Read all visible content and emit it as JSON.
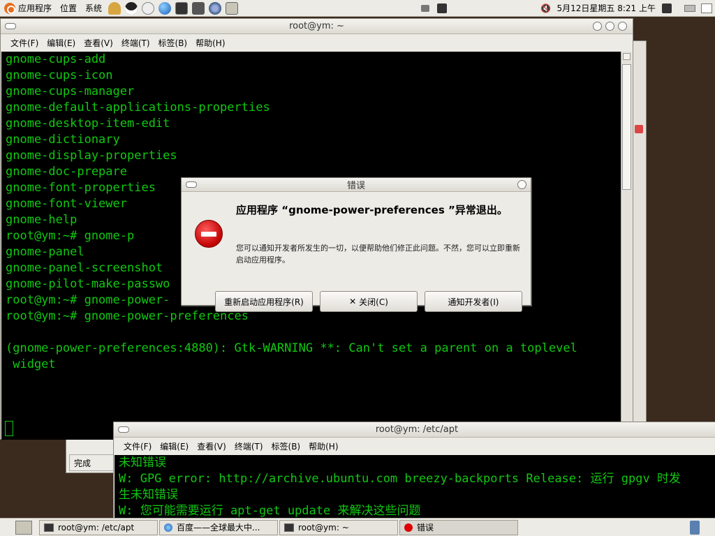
{
  "top_panel": {
    "menus": [
      "应用程序",
      "位置",
      "系统"
    ],
    "clock": "5月12日星期五  8:21 上午"
  },
  "main_window": {
    "title": "root@ym: ~",
    "menus": [
      "文件(F)",
      "编辑(E)",
      "查看(V)",
      "终端(T)",
      "标签(B)",
      "帮助(H)"
    ],
    "lines": [
      "gnome-cups-add",
      "gnome-cups-icon",
      "gnome-cups-manager",
      "gnome-default-applications-properties",
      "gnome-desktop-item-edit",
      "gnome-dictionary",
      "gnome-display-properties",
      "gnome-doc-prepare",
      "gnome-font-properties",
      "gnome-font-viewer",
      "gnome-help",
      "root@ym:~# gnome-p",
      "gnome-panel",
      "gnome-panel-screenshot",
      "gnome-pilot-make-passwo",
      "root@ym:~# gnome-power-",
      "root@ym:~# gnome-power-preferences",
      "",
      "(gnome-power-preferences:4880): Gtk-WARNING **: Can't set a parent on a toplevel",
      " widget"
    ]
  },
  "dialog": {
    "title": "错误",
    "heading": "应用程序 “gnome-power-preferences ”异常退出。",
    "message": "您可以通知开发者所发生的一切，以便帮助他们修正此问题。不然，您可以立即重新启动应用程序。",
    "restart_label": "重新启动应用程序(R)",
    "close_label": "关闭(C)",
    "notify_label": "通知开发者(I)"
  },
  "back_window": {
    "status": "完成"
  },
  "apt_window": {
    "title": "root@ym: /etc/apt",
    "menus": [
      "文件(F)",
      "编辑(E)",
      "查看(V)",
      "终端(T)",
      "标签(B)",
      "帮助(H)"
    ],
    "lines": [
      "未知错误",
      "W: GPG error: http://archive.ubuntu.com breezy-backports Release: 运行 gpgv 时发",
      "生未知错误",
      "W: 您可能需要运行 apt-get update 来解决这些问题"
    ]
  },
  "taskbar": {
    "tasks": [
      "root@ym: /etc/apt",
      "百度——全球最大中...",
      "root@ym: ~",
      "错误"
    ]
  }
}
